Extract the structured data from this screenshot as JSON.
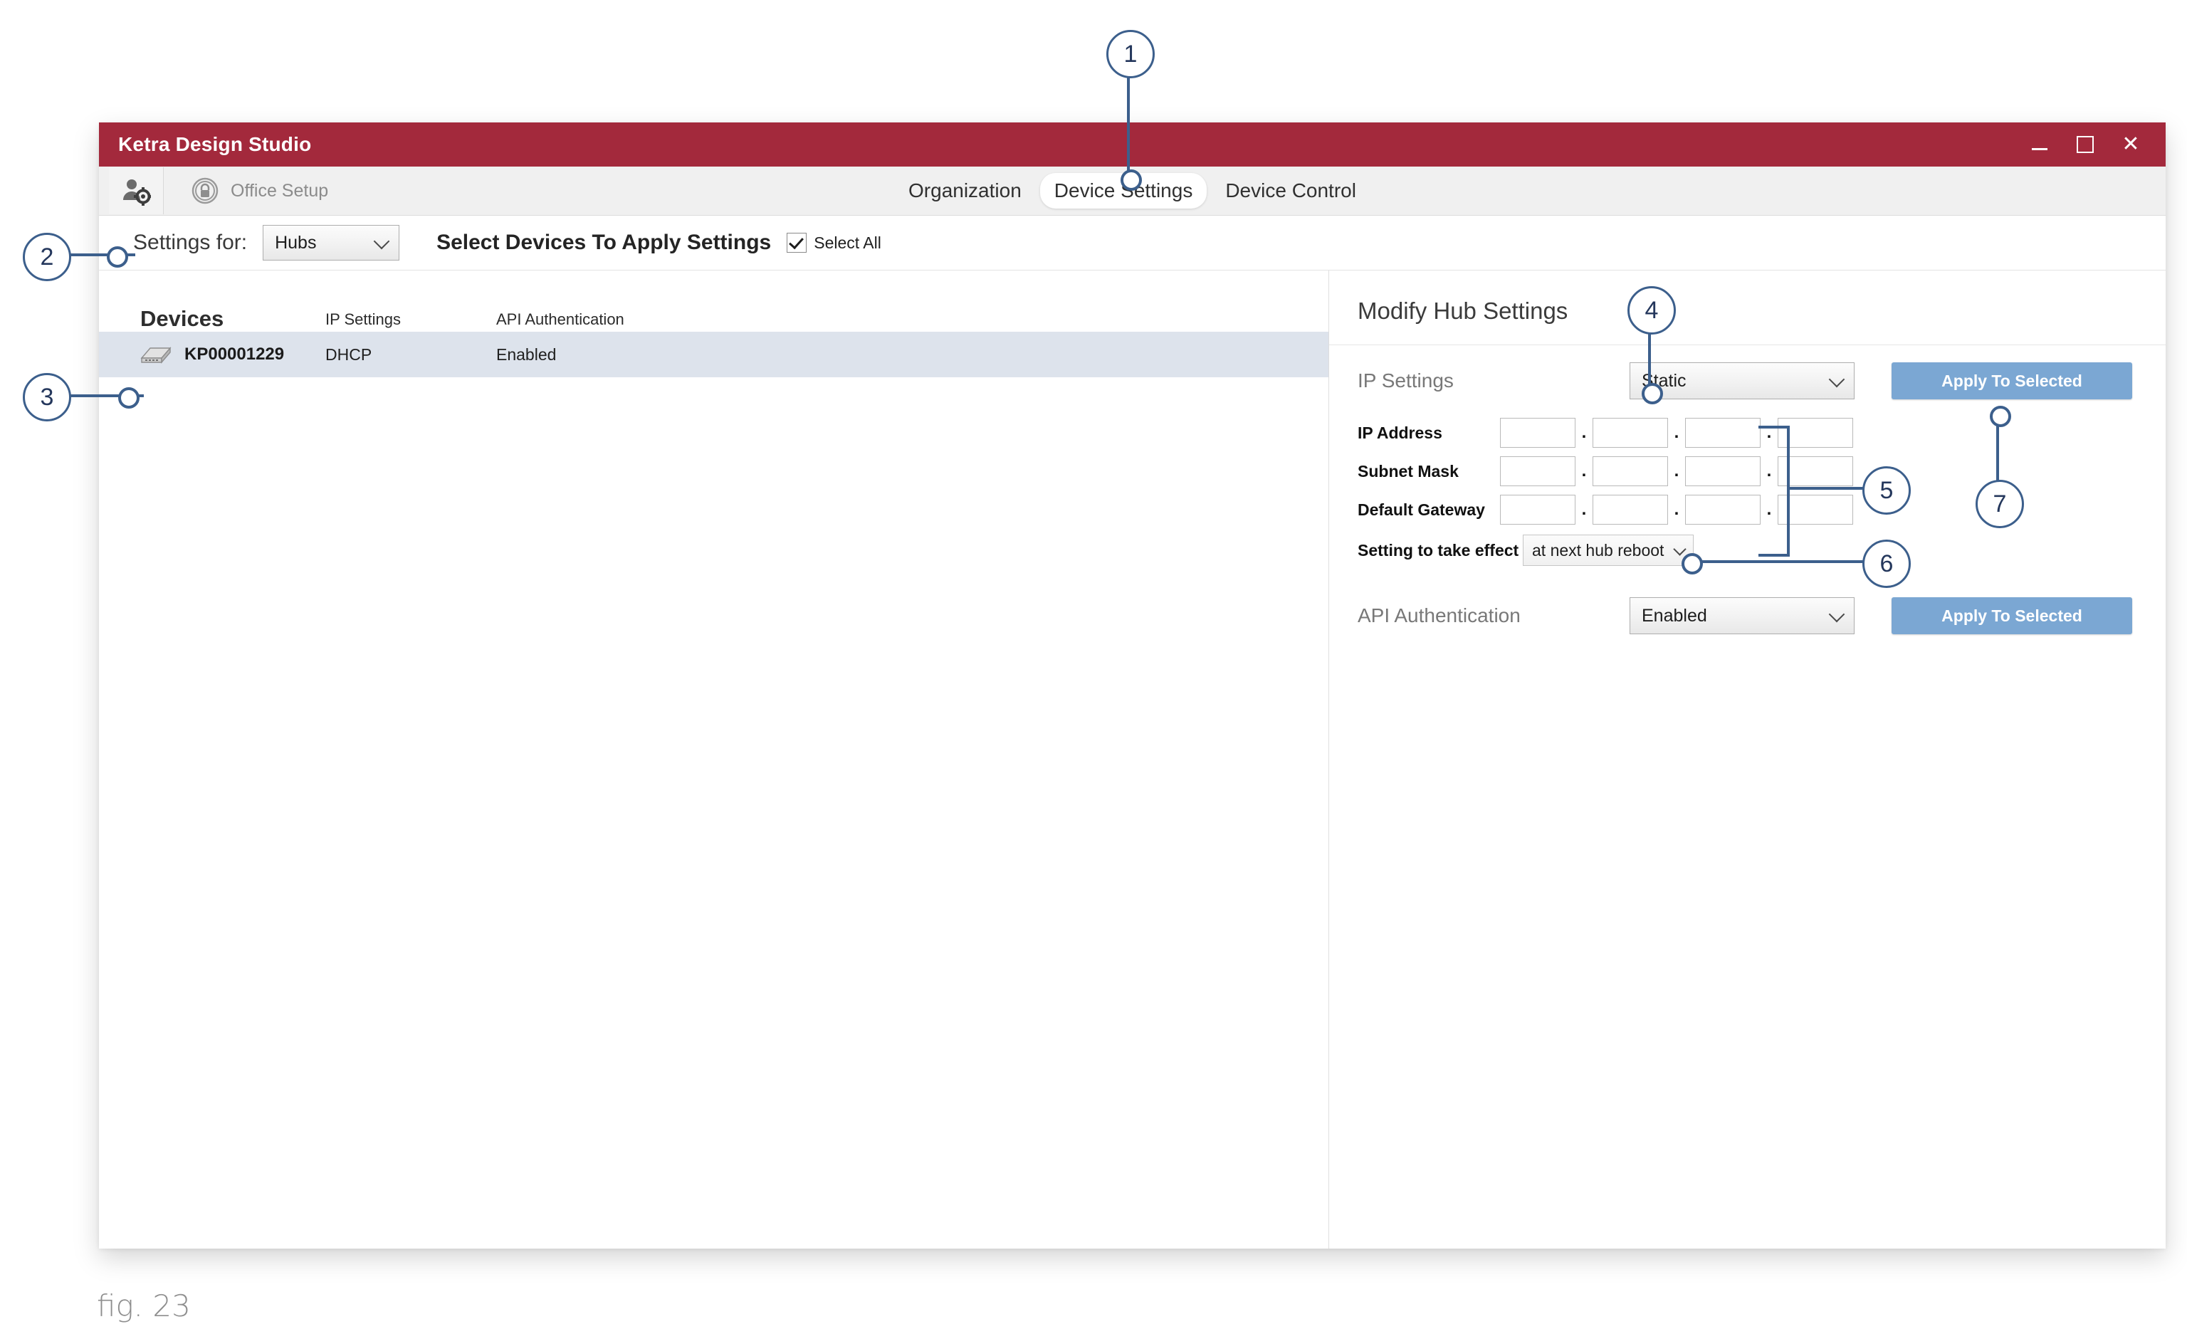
{
  "window": {
    "title": "Ketra Design Studio",
    "controls": [
      {
        "name": "minimize",
        "icon": "minimize-icon"
      },
      {
        "name": "maximize",
        "icon": "maximize-icon"
      },
      {
        "name": "close",
        "icon": "close-icon",
        "glyph": "✕"
      }
    ]
  },
  "toolbar": {
    "user_icon": "user-settings-icon",
    "lock_icon": "lock-circle-icon",
    "office_label": "Office Setup"
  },
  "nav": {
    "tabs": [
      {
        "label": "Organization",
        "active": false
      },
      {
        "label": "Device Settings",
        "active": true
      },
      {
        "label": "Device Control",
        "active": false
      }
    ]
  },
  "settings_strip": {
    "settings_for_label": "Settings for:",
    "settings_for_value": "Hubs",
    "select_devices_heading": "Select Devices To Apply Settings",
    "select_all_label": "Select All",
    "select_all_checked": true
  },
  "devices": {
    "title": "Devices",
    "columns": [
      "IP Settings",
      "API Authentication"
    ],
    "rows": [
      {
        "icon": "hub-device-icon",
        "name": "KP00001229",
        "ip_settings": "DHCP",
        "api_authentication": "Enabled",
        "selected": true
      }
    ]
  },
  "modify_panel": {
    "heading": "Modify Hub Settings",
    "ip_settings_label": "IP Settings",
    "ip_settings_value": "Static",
    "apply_ip_label": "Apply To Selected",
    "ip_address_label": "IP Address",
    "subnet_mask_label": "Subnet Mask",
    "default_gateway_label": "Default Gateway",
    "octet_value": "",
    "octet_separator": ".",
    "take_effect_label": "Setting to take effect",
    "take_effect_value": "at next hub reboot",
    "api_auth_label": "API Authentication",
    "api_auth_value": "Enabled",
    "apply_api_label": "Apply To Selected"
  },
  "callouts": {
    "c1": "1",
    "c2": "2",
    "c3": "3",
    "c4": "4",
    "c5": "5",
    "c6": "6",
    "c7": "7"
  },
  "figure": {
    "caption": "fig. 23"
  },
  "colors": {
    "titlebar": "#a3293c",
    "accent_button": "#7ba7d3",
    "callout": "#3c5f8c",
    "row_selected": "#dde3ec"
  }
}
